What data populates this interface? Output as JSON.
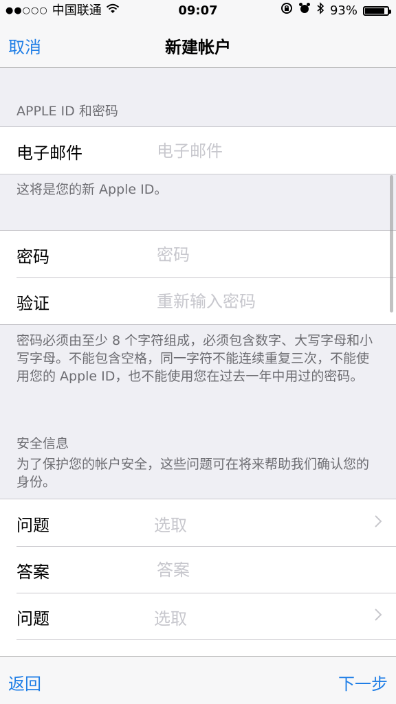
{
  "status_bar": {
    "signal_dots": "●●○○○",
    "carrier": "中国联通",
    "wifi_icon": "wifi-icon",
    "time": "09:07",
    "icons": [
      "lock-rotation-icon",
      "alarm-icon",
      "bluetooth-icon"
    ],
    "battery_percent": "93%",
    "battery_level": 0.93
  },
  "nav": {
    "cancel_label": "取消",
    "title": "新建帐户"
  },
  "apple_id_section": {
    "header": "APPLE ID 和密码",
    "email_label": "电子邮件",
    "email_placeholder": "电子邮件",
    "email_note": "这将是您的新 Apple ID。"
  },
  "password_section": {
    "password_label": "密码",
    "password_placeholder": "密码",
    "verify_label": "验证",
    "verify_placeholder": "重新输入密码",
    "note": "密码必须由至少 8 个字符组成，必须包含数字、大写字母和小写字母。不能包含空格，同一字符不能连续重复三次，不能使用您的 Apple ID，也不能使用您在过去一年中用过的密码。"
  },
  "security_section": {
    "header": "安全信息",
    "description": "为了保护您的帐户安全，这些问题可在将来帮助我们确认您的身份。",
    "rows": [
      {
        "label": "问题",
        "value": "选取"
      },
      {
        "label": "答案",
        "placeholder": "答案"
      },
      {
        "label": "问题",
        "value": "选取"
      }
    ]
  },
  "toolbar": {
    "back_label": "返回",
    "next_label": "下一步"
  }
}
